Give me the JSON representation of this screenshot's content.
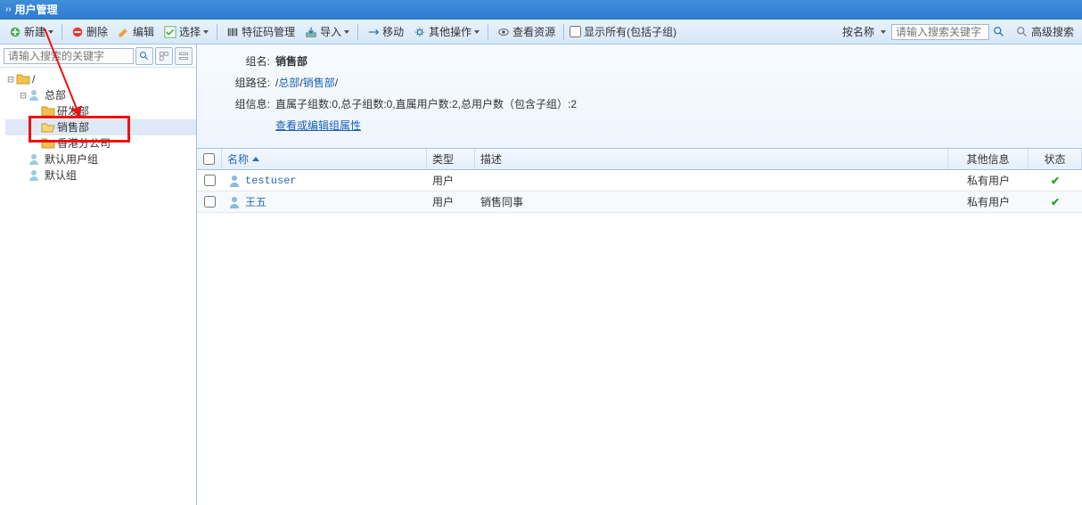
{
  "title": "用户管理",
  "toolbar": {
    "new": "新建",
    "delete": "删除",
    "edit": "编辑",
    "select": "选择",
    "feature": "特征码管理",
    "import": "导入",
    "move": "移动",
    "other": "其他操作",
    "view_res": "查看资源",
    "show_all": "显示所有(包括子组)",
    "search_by": "按名称",
    "search_placeholder": "请输入搜索关键字",
    "adv_search": "高级搜索"
  },
  "side_search_placeholder": "请输入搜索的关键字",
  "tree": {
    "root": "/",
    "hq": "总部",
    "rd": "研发部",
    "sales": "销售部",
    "hk": "香港分公司",
    "def_user": "默认用户组",
    "def_group": "默认组"
  },
  "info": {
    "group_name_label": "组名:",
    "group_name": "销售部",
    "path_label": "组路径:",
    "path_root": "总部",
    "path_cur": "销售部",
    "info_label": "组信息:",
    "info_text": "直属子组数:0,总子组数:0,直属用户数:2,总用户数（包含子组）:2",
    "edit_link": "查看或编辑组属性"
  },
  "columns": {
    "name": "名称",
    "type": "类型",
    "desc": "描述",
    "other": "其他信息",
    "state": "状态"
  },
  "rows": [
    {
      "name": "testuser",
      "type": "用户",
      "desc": "",
      "other": "私有用户",
      "state": "ok"
    },
    {
      "name": "王五",
      "type": "用户",
      "desc": "销售同事",
      "other": "私有用户",
      "state": "ok"
    }
  ]
}
